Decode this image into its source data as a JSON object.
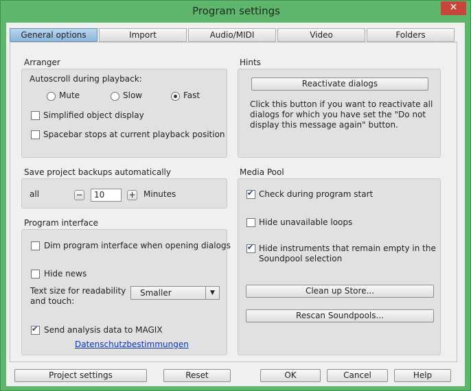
{
  "window": {
    "title": "Program settings",
    "close_glyph": "✕"
  },
  "tabs": [
    "General options",
    "Import",
    "Audio/MIDI",
    "Video",
    "Folders"
  ],
  "arranger": {
    "label": "Arranger",
    "autoscroll_label": "Autoscroll during playback:",
    "radios": [
      "Mute",
      "Slow",
      "Fast"
    ],
    "radio_selected": "Fast",
    "simplified_display": "Simplified object display",
    "spacebar_stops": "Spacebar stops at current playback position"
  },
  "backups": {
    "label": "Save project backups automatically",
    "all_label": "all",
    "minus": "−",
    "value": "10",
    "plus": "+",
    "unit": "Minutes"
  },
  "program_interface": {
    "label": "Program interface",
    "dim_interface": "Dim program interface when opening dialogs",
    "hide_news": "Hide news",
    "text_size_label_1": "Text size for readability",
    "text_size_label_2": "and touch:",
    "text_size_value": "Smaller",
    "send_analysis": "Send analysis data to MAGIX",
    "privacy_link": "Datenschutzbestimmungen"
  },
  "hints": {
    "label": "Hints",
    "reactivate_button": "Reactivate dialogs",
    "line1": "Click this button if you want to reactivate all",
    "line2": "dialogs for which you have set the \"Do not",
    "line3": "display this message again\" button."
  },
  "media_pool": {
    "label": "Media Pool",
    "check_start": "Check during program start",
    "hide_unavailable": "Hide unavailable loops",
    "hide_instruments_1": "Hide instruments that remain empty in the",
    "hide_instruments_2": "Soundpool selection",
    "clean_store": "Clean up Store...",
    "rescan": "Rescan Soundpools..."
  },
  "footer": {
    "project_settings": "Project settings",
    "reset": "Reset",
    "ok": "OK",
    "cancel": "Cancel",
    "help": "Help"
  },
  "icons": {
    "close": "close-icon",
    "checkmark": "checkmark-icon",
    "dropdown": "chevron-down-icon"
  }
}
